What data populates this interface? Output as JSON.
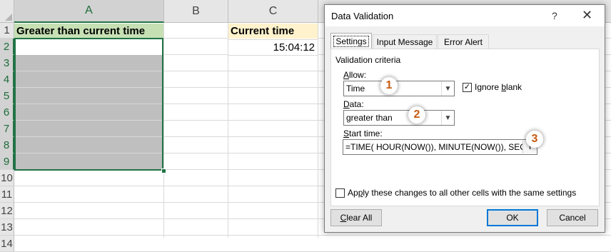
{
  "sheet": {
    "columns": [
      "A",
      "B",
      "C"
    ],
    "rows": [
      "1",
      "2",
      "3",
      "4",
      "5",
      "6",
      "7",
      "8",
      "9",
      "10",
      "11",
      "12",
      "13",
      "14"
    ],
    "a1": "Greater than current time",
    "c1": "Current time",
    "c2": "15:04:12",
    "colors": {
      "header_green": "#c6e0b4",
      "header_yellow": "#fff2cc",
      "gray_fill": "#bfbfbf",
      "selection": "#217346"
    }
  },
  "dialog": {
    "title": "Data Validation",
    "help_label": "?",
    "close_label": "✕",
    "tabs": [
      "Settings",
      "Input Message",
      "Error Alert"
    ],
    "validation_criteria_label": "Validation criteria",
    "allow": {
      "label_underline": "A",
      "label_rest": "llow:",
      "value": "Time"
    },
    "ignore_blank": {
      "label_prefix": "Ignore ",
      "label_underline": "b",
      "label_rest": "lank",
      "checked": true,
      "mark": "✓"
    },
    "data": {
      "label_underline": "D",
      "label_rest": "ata:",
      "value": "greater than"
    },
    "start_time": {
      "label_underline": "S",
      "label_rest": "tart time:",
      "value": "=TIME( HOUR(NOW()), MINUTE(NOW()), SECOND(NOW()))"
    },
    "apply_all": {
      "label_prefix": "Ap",
      "label_underline": "p",
      "label_rest": "ly these changes to all other cells with the same settings",
      "checked": false
    },
    "badges": [
      "1",
      "2",
      "3"
    ],
    "buttons": {
      "clear_all_underline": "C",
      "clear_all_rest": "lear All",
      "ok": "OK",
      "cancel": "Cancel"
    }
  }
}
